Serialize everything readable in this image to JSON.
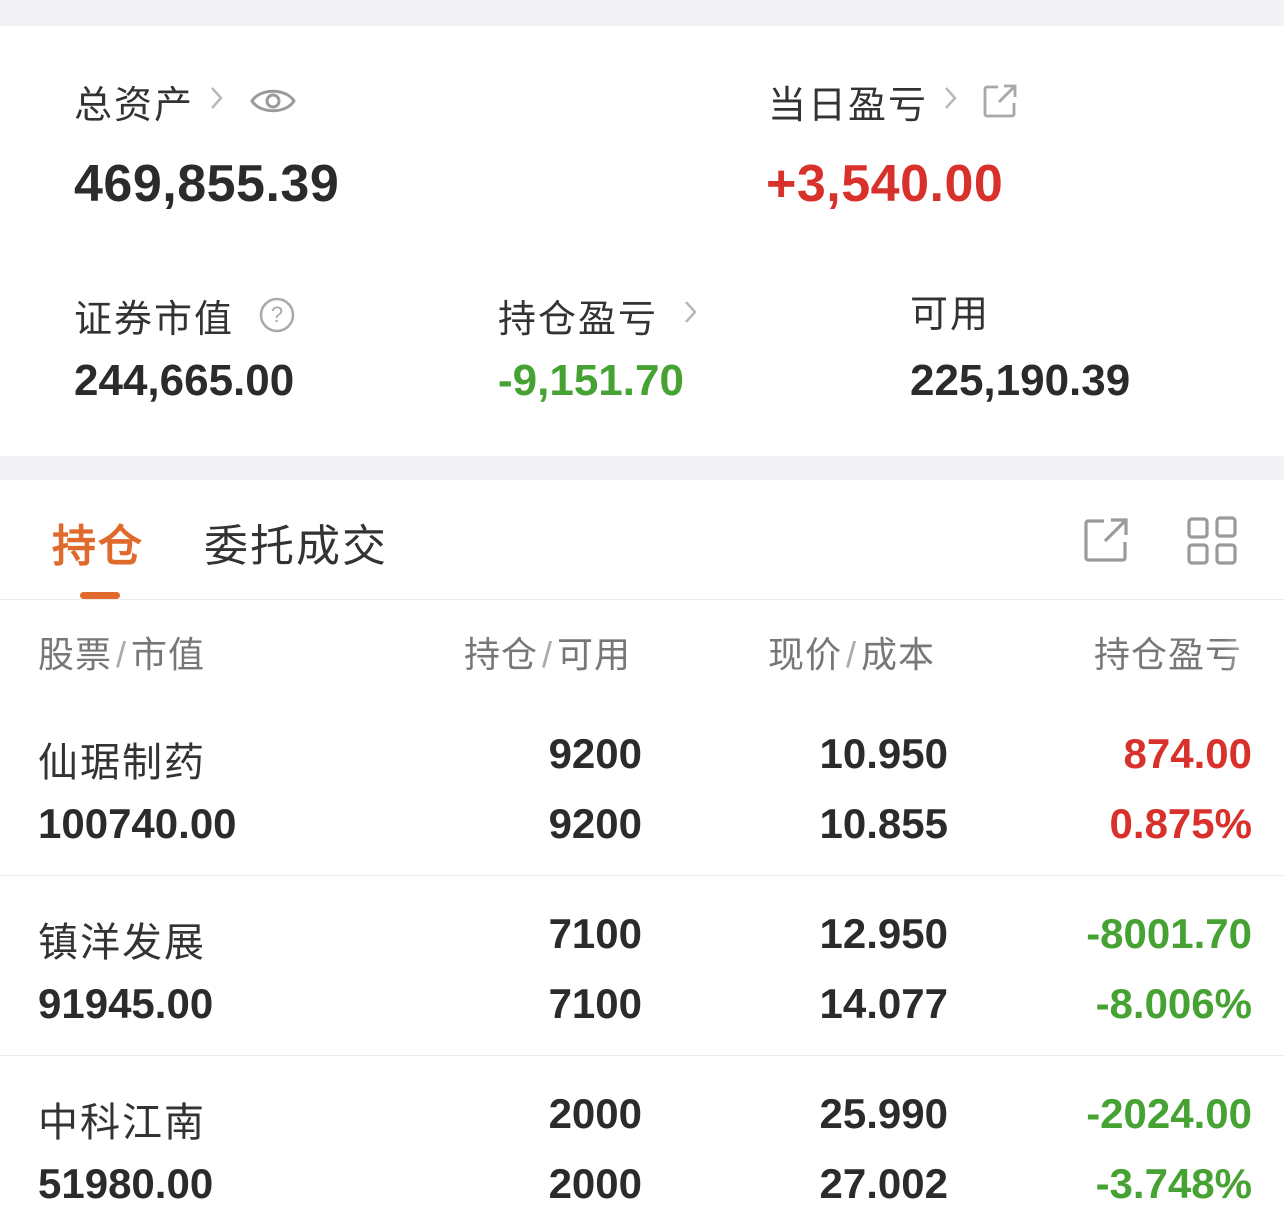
{
  "summary": {
    "total_assets": {
      "label": "总资产",
      "value": "469,855.39"
    },
    "daily_pnl": {
      "label": "当日盈亏",
      "value": "+3,540.00"
    },
    "market_value": {
      "label": "证券市值",
      "value": "244,665.00"
    },
    "position_pnl": {
      "label": "持仓盈亏",
      "value": "-9,151.70"
    },
    "available": {
      "label": "可用",
      "value": "225,190.39"
    }
  },
  "tabs": [
    {
      "label": "持仓",
      "active": true
    },
    {
      "label": "委托成交",
      "active": false
    }
  ],
  "columns": {
    "stock": "股票",
    "market_value": "市值",
    "position": "持仓",
    "available": "可用",
    "price": "现价",
    "cost": "成本",
    "pnl": "持仓盈亏",
    "separator": "/"
  },
  "positions": [
    {
      "name": "仙琚制药",
      "market_value": "100740.00",
      "position": "9200",
      "available": "9200",
      "price": "10.950",
      "cost": "10.855",
      "pnl": "874.00",
      "pnl_pct": "0.875%",
      "trend": "up"
    },
    {
      "name": "镇洋发展",
      "market_value": "91945.00",
      "position": "7100",
      "available": "7100",
      "price": "12.950",
      "cost": "14.077",
      "pnl": "-8001.70",
      "pnl_pct": "-8.006%",
      "trend": "down"
    },
    {
      "name": "中科江南",
      "market_value": "51980.00",
      "position": "2000",
      "available": "2000",
      "price": "25.990",
      "cost": "27.002",
      "pnl": "-2024.00",
      "pnl_pct": "-3.748%",
      "trend": "down"
    }
  ],
  "colors": {
    "gain": "#d8302a",
    "loss": "#46a233",
    "accent": "#e06a2c"
  }
}
